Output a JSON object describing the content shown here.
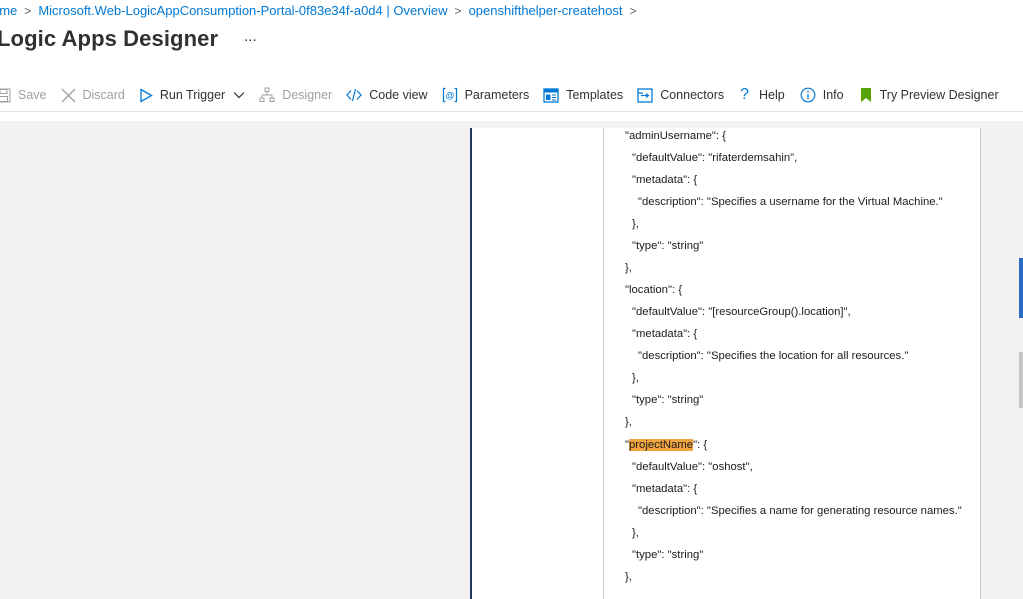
{
  "breadcrumb": {
    "home": "ome",
    "resource": "Microsoft.Web-LogicAppConsumption-Portal-0f83e34f-a0d4 | Overview",
    "app": "openshifthelper-createhost"
  },
  "page": {
    "title": "Logic Apps Designer",
    "more": "..."
  },
  "toolbar": {
    "save": "Save",
    "discard": "Discard",
    "run_trigger": "Run Trigger",
    "designer": "Designer",
    "code_view": "Code view",
    "parameters": "Parameters",
    "templates": "Templates",
    "connectors": "Connectors",
    "help": "Help",
    "info": "Info",
    "try_preview": "Try Preview Designer"
  },
  "code": {
    "l1": "\"adminUsername\": {",
    "l2": "\"defaultValue\": \"rifaterdemsahin\",",
    "l3": "\"metadata\": {",
    "l4": "\"description\": \"Specifies a username for the Virtual Machine.\"",
    "l5": "},",
    "l6": "\"type\": \"string\"",
    "l7": "},",
    "l8": "\"location\": {",
    "l9": "\"defaultValue\": \"[resourceGroup().location]\",",
    "l10": "\"metadata\": {",
    "l11": "\"description\": \"Specifies the location for all resources.\"",
    "l12": "},",
    "l13": "\"type\": \"string\"",
    "l14": "},",
    "l15_quote": "\"",
    "l15_key": "projectName",
    "l15_rest": "\": {",
    "l16": "\"defaultValue\": \"oshost\",",
    "l17": "\"metadata\": {",
    "l18": "\"description\": \"Specifies a name for generating resource names.\"",
    "l19": "},",
    "l20": "\"type\": \"string\"",
    "l21": "},"
  },
  "colors": {
    "accent": "#0078d4",
    "highlight": "#f0a540",
    "canvas": "#f3f2f1"
  }
}
